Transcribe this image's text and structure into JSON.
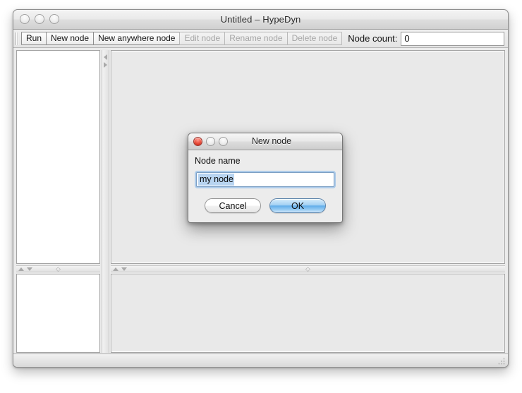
{
  "window": {
    "title": "Untitled – HypeDyn",
    "traffic_lights": [
      "close-button",
      "minimize-button",
      "zoom-button"
    ]
  },
  "toolbar": {
    "buttons": [
      {
        "label": "Run",
        "enabled": true
      },
      {
        "label": "New node",
        "enabled": true
      },
      {
        "label": "New anywhere node",
        "enabled": true
      },
      {
        "label": "Edit node",
        "enabled": false
      },
      {
        "label": "Rename node",
        "enabled": false
      },
      {
        "label": "Delete node",
        "enabled": false
      }
    ],
    "node_count_label": "Node count:",
    "node_count_value": "0"
  },
  "panes": {
    "left_top": "",
    "left_bottom": "",
    "right_top": "",
    "right_bottom": ""
  },
  "dialog": {
    "title": "New node",
    "field_label": "Node name",
    "field_value": "my node",
    "field_placeholder": "",
    "cancel_label": "Cancel",
    "ok_label": "OK",
    "close_button_color": "#d93a22"
  }
}
